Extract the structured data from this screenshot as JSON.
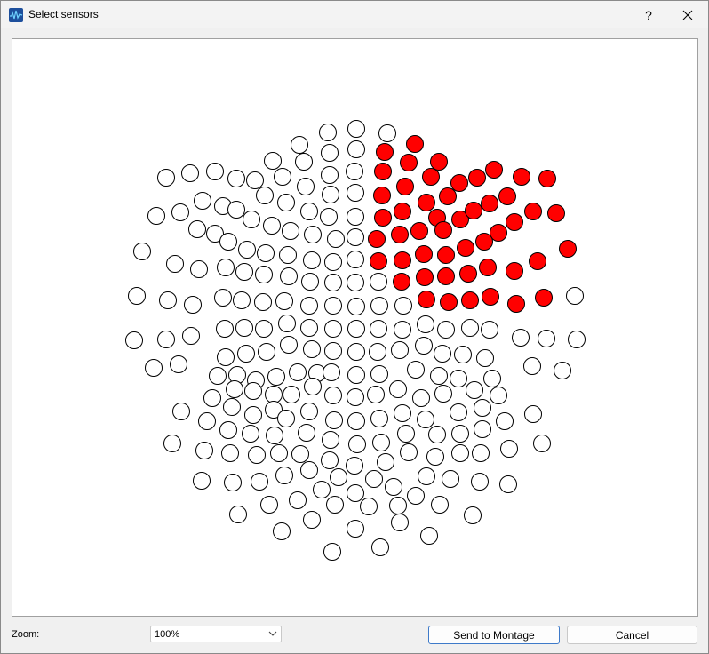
{
  "window": {
    "title": "Select sensors",
    "help_label": "?",
    "app_icon": "waveform-app-icon",
    "close_icon": "close-icon"
  },
  "sensors": {
    "selected_color": "#ff0000",
    "unselected_color": "#ffffff",
    "outline_color": "#000000"
  },
  "footer": {
    "zoom_label": "Zoom:",
    "zoom_value": "100%",
    "send_label": "Send to Montage",
    "cancel_label": "Cancel"
  }
}
